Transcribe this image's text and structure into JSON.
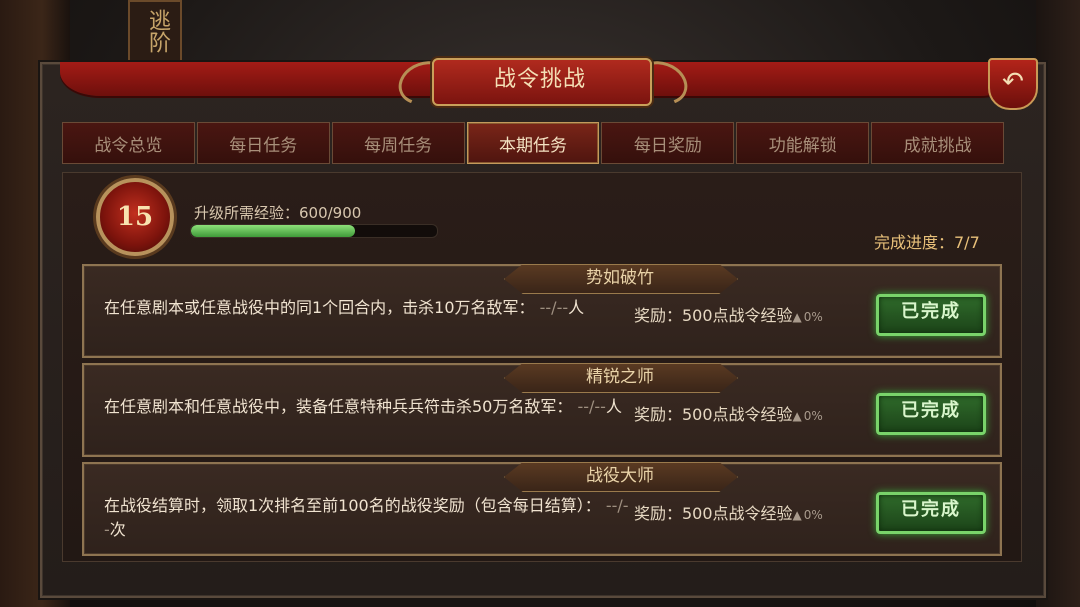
{
  "background": {
    "banner_text": "逃阶"
  },
  "header": {
    "title": "战令挑战",
    "back_icon": "back-arrow-icon"
  },
  "tabs": [
    {
      "label": "战令总览",
      "active": false
    },
    {
      "label": "每日任务",
      "active": false
    },
    {
      "label": "每周任务",
      "active": false
    },
    {
      "label": "本期任务",
      "active": true
    },
    {
      "label": "每日奖励",
      "active": false
    },
    {
      "label": "功能解锁",
      "active": false
    },
    {
      "label": "成就挑战",
      "active": false
    }
  ],
  "level": {
    "value": "15"
  },
  "experience": {
    "label": "升级所需经验：600/900",
    "fraction": 0.667
  },
  "completion": {
    "text": "完成进度：7/7"
  },
  "tasks": [
    {
      "title": "势如破竹",
      "desc": "在任意剧本或任意战役中的同1个回合内，击杀10万名敌军：",
      "progress": " --/--",
      "unit": "人",
      "reward": "奖励：500点战令经验",
      "bonus": "0%",
      "status": "已完成"
    },
    {
      "title": "精锐之师",
      "desc": "在任意剧本和任意战役中，装备任意特种兵兵符击杀50万名敌军：",
      "progress": " --/--",
      "unit": "人",
      "reward": "奖励：500点战令经验",
      "bonus": "0%",
      "status": "已完成"
    },
    {
      "title": "战役大师",
      "desc": "在战役结算时，领取1次排名至前100名的战役奖励（包含每日结算）：",
      "progress": " --/--",
      "unit": "次",
      "reward": "奖励：500点战令经验",
      "bonus": "0%",
      "status": "已完成"
    }
  ],
  "colors": {
    "accent_red": "#a41c16",
    "gold": "#c9a05a",
    "done_green": "#79d36a"
  }
}
